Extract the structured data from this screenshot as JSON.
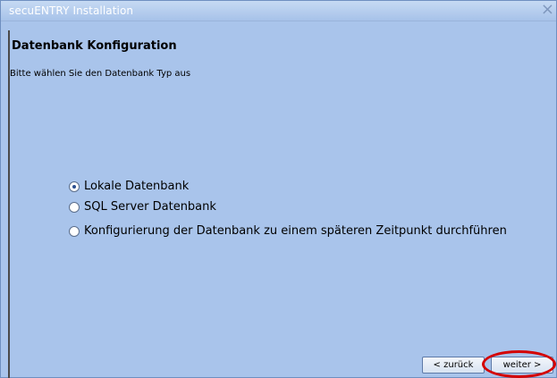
{
  "window": {
    "title": "secuENTRY Installation",
    "close_glyph": "×"
  },
  "page": {
    "heading": "Datenbank Konfiguration",
    "subheading": "Bitte wählen Sie den Datenbank Typ aus"
  },
  "options": [
    {
      "label": "Lokale Datenbank",
      "checked": true
    },
    {
      "label": "SQL Server Datenbank",
      "checked": false
    },
    {
      "label": "Konfigurierung der Datenbank zu einem späteren Zeitpunkt durchführen",
      "checked": false
    }
  ],
  "buttons": {
    "back_label": "< zurück",
    "next_label": "weiter >"
  },
  "colors": {
    "background": "#a9c4eb",
    "highlight": "#d40000"
  }
}
